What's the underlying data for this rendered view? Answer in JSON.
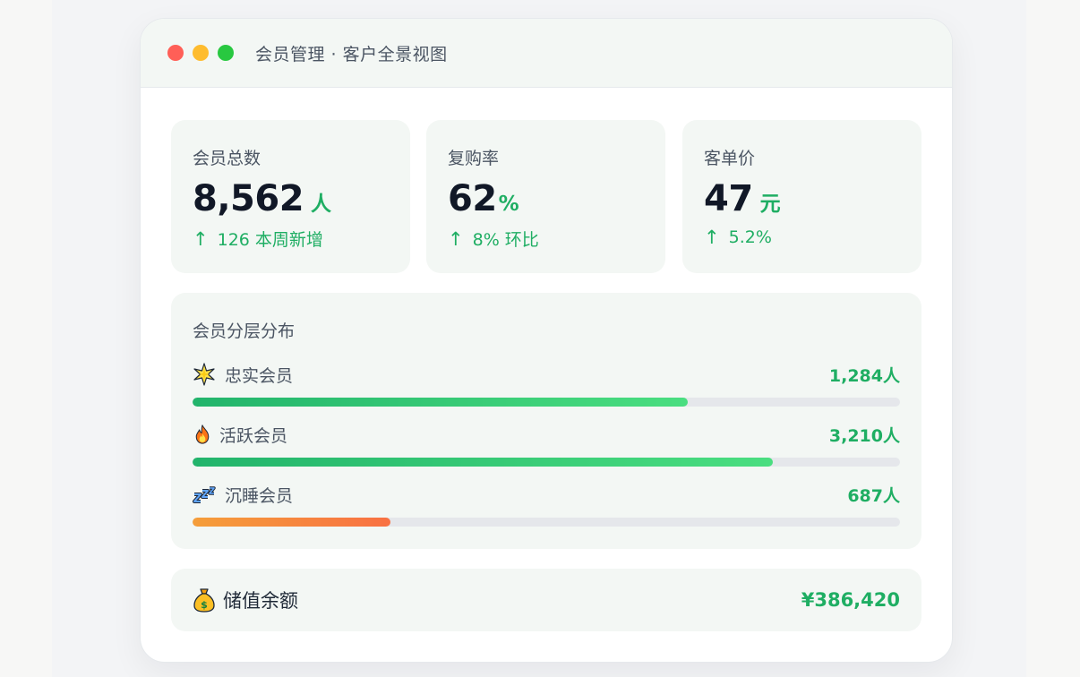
{
  "window": {
    "title": "会员管理 · 客户全景视图"
  },
  "stats": [
    {
      "label": "会员总数",
      "value": "8,562",
      "unit": "人",
      "trend": "126 本周新增",
      "trend_icon": "up-arrow-icon"
    },
    {
      "label": "复购率",
      "value": "62",
      "unit": "%",
      "trend": "8% 环比",
      "trend_icon": "up-arrow-icon"
    },
    {
      "label": "客单价",
      "value": "47",
      "unit": "元",
      "trend": "5.2%",
      "trend_icon": "up-arrow-icon"
    }
  ],
  "distribution": {
    "heading": "会员分层分布",
    "tiers": [
      {
        "name": "忠实会员",
        "count": "1,284人",
        "icon": "sparkle-star-icon",
        "fill": 0.7,
        "color": "green"
      },
      {
        "name": "活跃会员",
        "count": "3,210人",
        "icon": "fire-icon",
        "fill": 0.82,
        "color": "green"
      },
      {
        "name": "沉睡会员",
        "count": "687人",
        "icon": "zzz-sleep-icon",
        "fill": 0.28,
        "color": "orange"
      }
    ]
  },
  "balance": {
    "label": "储值余额",
    "amount": "¥386,420",
    "icon": "money-bag-icon"
  },
  "colors": {
    "accent": "#1fae63",
    "card_bg": "#f3f7f4",
    "warning": "#f87143"
  }
}
